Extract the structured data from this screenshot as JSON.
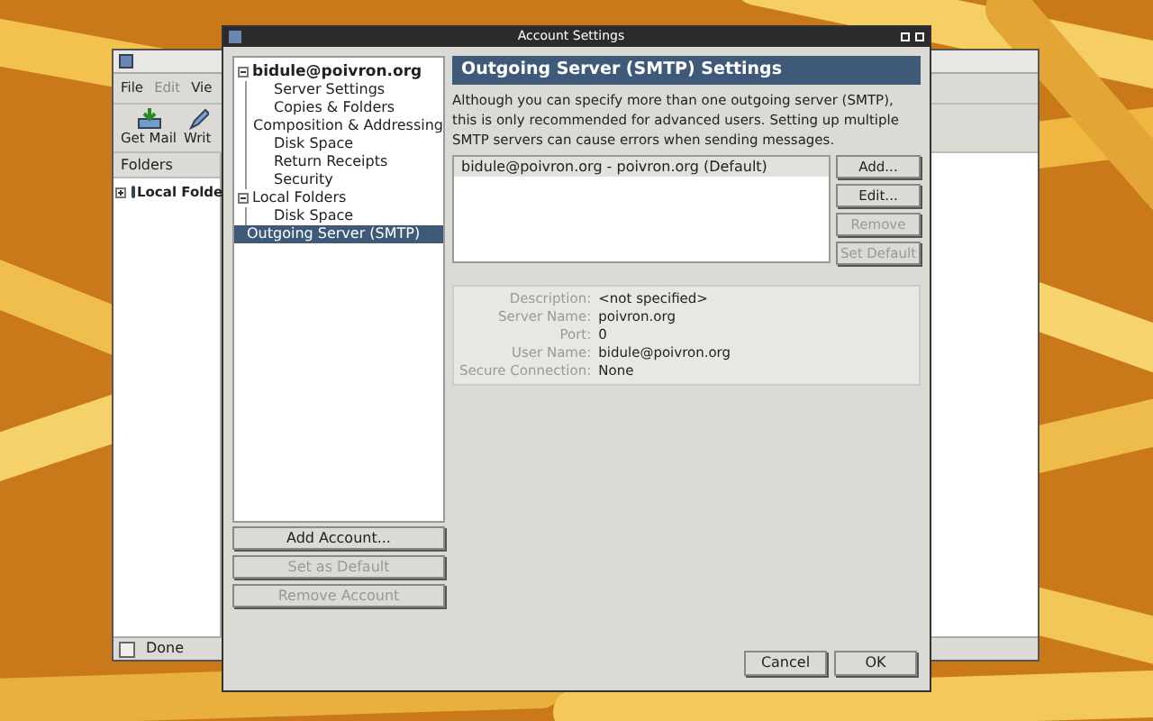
{
  "mail_window": {
    "menu": [
      {
        "label": "File",
        "disabled": false
      },
      {
        "label": "Edit",
        "disabled": true
      },
      {
        "label": "Vie",
        "disabled": false
      }
    ],
    "toolbar": [
      {
        "label": "Get Mail",
        "kind": "getmail"
      },
      {
        "label": "Writ",
        "kind": "write"
      }
    ],
    "folders_header": "Folders",
    "folders": [
      {
        "label": "Local Folde",
        "expanded": false
      }
    ],
    "status": "Done"
  },
  "dialog": {
    "title": "Account Settings",
    "tree": [
      {
        "label": "bidule@poivron.org",
        "bold": true,
        "expanded": true,
        "selected": false,
        "children": [
          {
            "label": "Server Settings",
            "selected": false
          },
          {
            "label": "Copies & Folders",
            "selected": false
          },
          {
            "label": "Composition & Addressing",
            "selected": false
          },
          {
            "label": "Disk Space",
            "selected": false
          },
          {
            "label": "Return Receipts",
            "selected": false
          },
          {
            "label": "Security",
            "selected": false
          }
        ]
      },
      {
        "label": "Local Folders",
        "bold": false,
        "expanded": true,
        "selected": false,
        "children": [
          {
            "label": "Disk Space",
            "selected": false
          }
        ]
      },
      {
        "label": "Outgoing Server (SMTP)",
        "bold": false,
        "selected": true
      }
    ],
    "account_buttons": [
      {
        "label": "Add Account...",
        "disabled": false
      },
      {
        "label": "Set as Default",
        "disabled": true
      },
      {
        "label": "Remove Account",
        "disabled": true
      }
    ],
    "heading": "Outgoing Server (SMTP) Settings",
    "description": "Although you can specify more than one outgoing server (SMTP), this is only recommended for advanced users. Setting up multiple SMTP servers can cause errors when sending messages.",
    "servers": [
      {
        "label": "bidule@poivron.org - poivron.org (Default)",
        "selected": true
      }
    ],
    "server_buttons": [
      {
        "label": "Add...",
        "disabled": false
      },
      {
        "label": "Edit...",
        "disabled": false
      },
      {
        "label": "Remove",
        "disabled": true
      },
      {
        "label": "Set Default",
        "disabled": true
      }
    ],
    "details": [
      {
        "label": "Description:",
        "value": "<not specified>"
      },
      {
        "label": "Server Name:",
        "value": "poivron.org"
      },
      {
        "label": "Port:",
        "value": "0"
      },
      {
        "label": "User Name:",
        "value": "bidule@poivron.org"
      },
      {
        "label": "Secure Connection:",
        "value": "None"
      }
    ],
    "buttons": [
      {
        "label": "Cancel"
      },
      {
        "label": "OK"
      }
    ]
  }
}
